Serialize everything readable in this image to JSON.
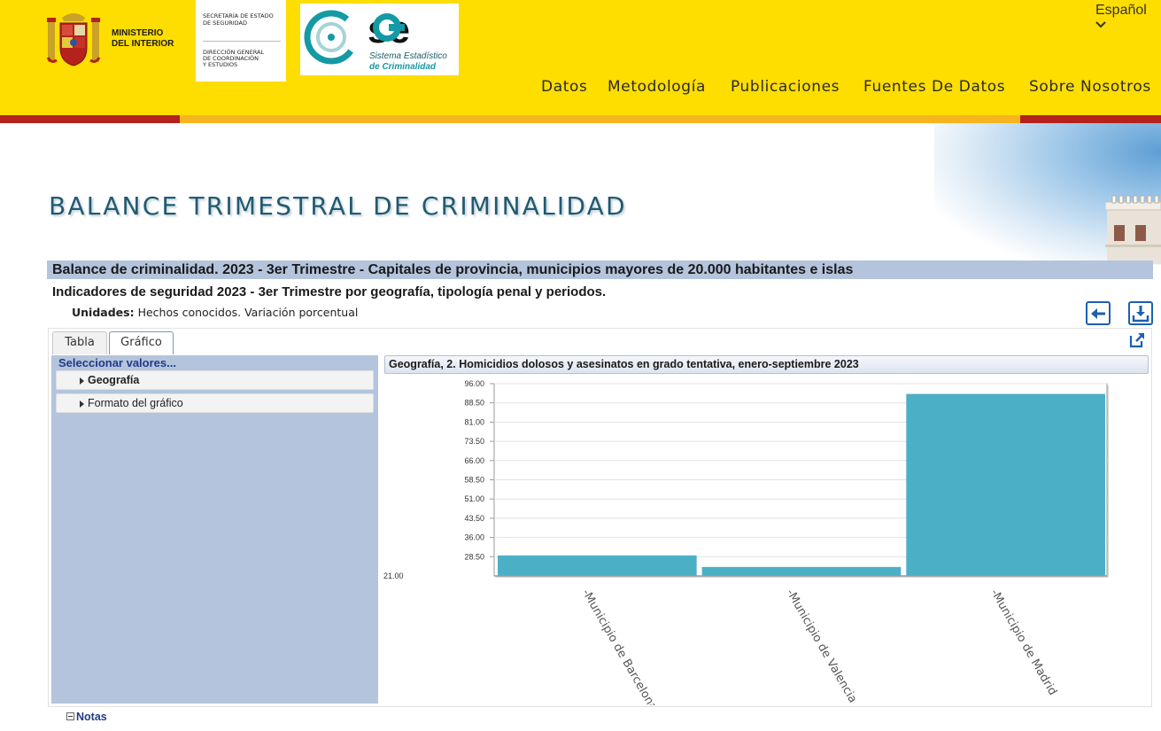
{
  "header": {
    "ministry_label": "MINISTERIO\nDEL INTERIOR",
    "secretaria_line1": "SECRETARÍA DE ESTADO\nDE SEGURIDAD",
    "secretaria_line2": "DIRECCIÓN GENERAL\nDE COORDINACIÓN\nY ESTUDIOS",
    "sec_word": "se",
    "sec_subtitle1": "Sistema Estadístico",
    "sec_subtitle2": "de Criminalidad",
    "language": "Español",
    "nav": [
      "Datos",
      "Metodología",
      "Publicaciones",
      "Fuentes De Datos",
      "Sobre Nosotros"
    ]
  },
  "page": {
    "title": "BALANCE TRIMESTRAL DE CRIMINALIDAD",
    "table_title": "Balance de criminalidad. 2023 - 3er Trimestre - Capitales de provincia, municipios mayores de 20.000 habitantes e islas",
    "subtitle": "Indicadores de seguridad 2023 - 3er Trimestre por geografía, tipología penal y periodos.",
    "units_label": "Unidades:",
    "units_value": "Hechos conocidos. Variación porcentual"
  },
  "tabs": [
    "Tabla",
    "Gráfico"
  ],
  "left_panel": {
    "select_label": "Seleccionar valores...",
    "items": [
      "Geografía",
      "Formato del gráfico"
    ]
  },
  "chart_header": "Geografía, 2. Homicidios dolosos y asesinatos en grado tentativa, enero-septiembre 2023",
  "notes_label": "Notas",
  "icons": [
    "back-arrow-icon",
    "download-icon",
    "external-link-icon"
  ],
  "colors": {
    "header_yellow": "#fedd00",
    "accent_red": "#b5221c",
    "bar": "#4bb0c6",
    "title_blue": "#215a72"
  },
  "chart_data": {
    "type": "bar",
    "categories": [
      "-Municipio de Barcelona",
      "-Municipio de Valencia",
      "-Municipio de Madrid"
    ],
    "values": [
      29.0,
      24.5,
      92.0
    ],
    "yticks": [
      "96.00",
      "88.50",
      "81.00",
      "73.50",
      "66.00",
      "58.50",
      "51.00",
      "43.50",
      "36.00",
      "28.50",
      "21.00"
    ],
    "ylim": [
      21,
      96
    ],
    "grid": true,
    "title": "",
    "xlabel": "",
    "ylabel": ""
  }
}
